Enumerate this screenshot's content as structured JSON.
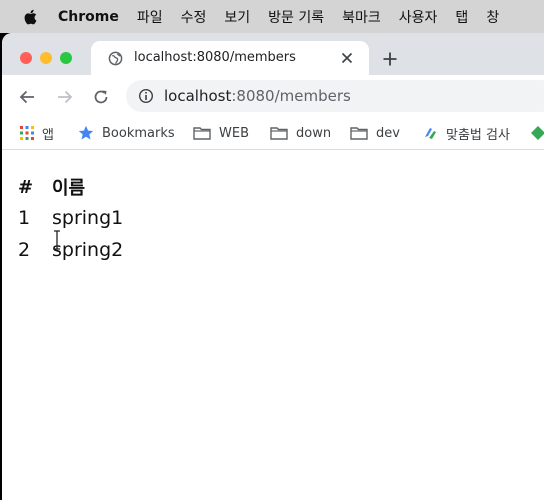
{
  "menubar": {
    "app_name": "Chrome",
    "items": [
      "파일",
      "수정",
      "보기",
      "방문 기록",
      "북마크",
      "사용자",
      "탭",
      "창"
    ]
  },
  "tab": {
    "title": "localhost:8080/members",
    "favicon": "globe-icon"
  },
  "omnibox": {
    "url_host": "localhost",
    "url_path": ":8080/members"
  },
  "bookmarks": {
    "items": [
      {
        "label": "앱",
        "icon": "apps-grid-icon"
      },
      {
        "label": "Bookmarks",
        "icon": "star-icon"
      },
      {
        "label": "WEB",
        "icon": "folder-icon"
      },
      {
        "label": "down",
        "icon": "folder-icon"
      },
      {
        "label": "dev",
        "icon": "folder-icon"
      },
      {
        "label": "맞춤법 검사",
        "icon": "spellcheck-icon"
      }
    ]
  },
  "page": {
    "headers": [
      "#",
      "이름"
    ],
    "rows": [
      [
        "1",
        "spring1"
      ],
      [
        "2",
        "spring2"
      ]
    ]
  },
  "colors": {
    "menubar_bg": "#d4d4d4",
    "tabstrip_bg": "#dee1e6",
    "omnibox_bg": "#f1f3f4",
    "star": "#4285f4"
  }
}
